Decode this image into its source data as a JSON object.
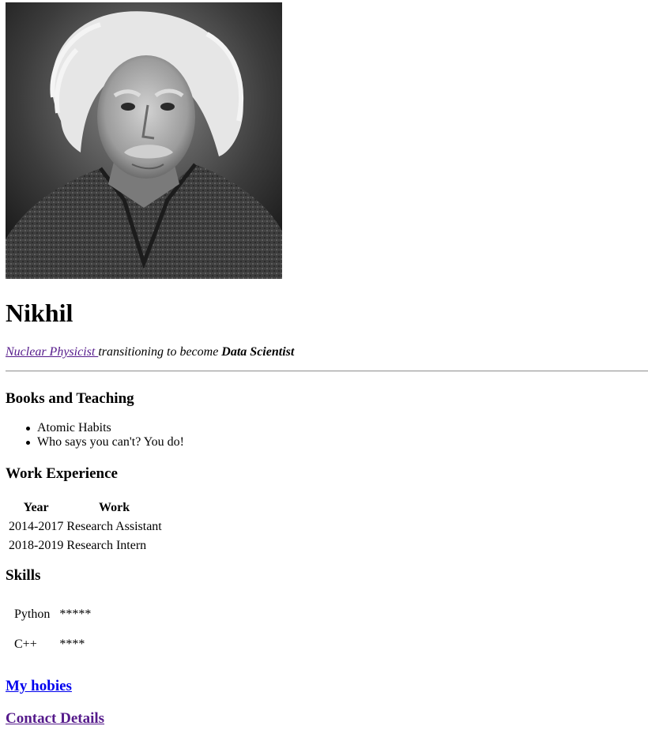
{
  "profile": {
    "photo_icon": "portrait-photo",
    "name": "Nikhil",
    "tagline": {
      "link_text": "Nuclear Physicist ",
      "middle_text": "transitioning to become ",
      "bold_text": "Data Scientist"
    }
  },
  "books": {
    "heading": "Books and Teaching",
    "items": [
      "Atomic Habits",
      "Who says you can't? You do!"
    ]
  },
  "work": {
    "heading": "Work Experience",
    "columns": [
      "Year",
      "Work"
    ],
    "rows": [
      [
        "2014-2017",
        "Research Assistant"
      ],
      [
        "2018-2019",
        "Research Intern"
      ]
    ]
  },
  "skills": {
    "heading": "Skills",
    "rows": [
      {
        "name": "Python",
        "stars": "*****"
      },
      {
        "name": "C++",
        "stars": "****"
      }
    ]
  },
  "links": {
    "hobbies": "My hobies",
    "contact": "Contact Details"
  },
  "colors": {
    "link_unvisited": "#0000ee",
    "link_visited": "#551a8b",
    "rule": "#9a9a9a"
  }
}
